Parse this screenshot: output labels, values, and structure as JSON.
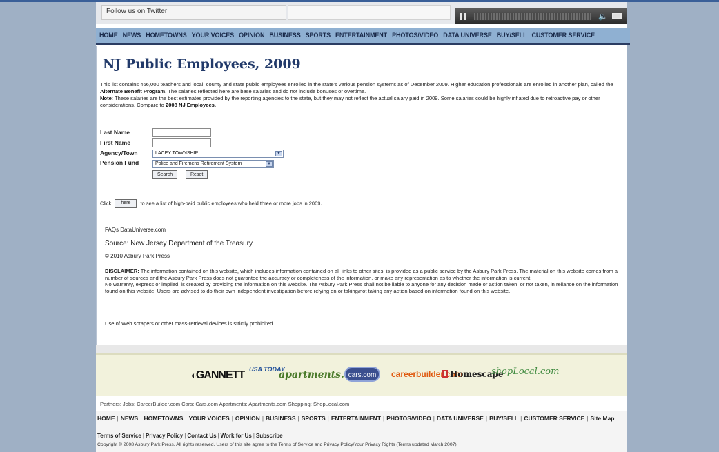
{
  "topbar": {
    "twitter_prefix": "Follow us on ",
    "twitter_link": "Twitter",
    "player_icons": [
      "pause-icon",
      "volume-icon",
      "fullscreen-icon"
    ]
  },
  "nav": {
    "items": [
      "HOME",
      "NEWS",
      "HOMETOWNS",
      "YOUR VOICES",
      "OPINION",
      "BUSINESS",
      "SPORTS",
      "ENTERTAINMENT",
      "PHOTOS/VIDEO",
      "DATA UNIVERSE",
      "BUY/SELL",
      "CUSTOMER SERVICE"
    ]
  },
  "page": {
    "title": "NJ Public Employees, 2009",
    "intro_1": "This list contains 466,000 teachers and local, county and state public employees enrolled in the state's various pension systems as of December 2009. Higher education professionals are enrolled in another plan, called the ",
    "intro_abp": "Alternate Benefit Program",
    "intro_2": ". The salaries reflected here are base salaries and do not include bonuses or overtime.",
    "note_label": "Note",
    "note_1": ": These salaries are the ",
    "note_link": "best estimates",
    "note_2": " provided by the reporting agencies to the state, but they may not reflect the actual salary paid in 2009. Some salaries could be highly inflated due to retroactive pay or other considerations. Compare to ",
    "note_compare": "2008 NJ Employees."
  },
  "form": {
    "last_name_label": "Last Name",
    "first_name_label": "First Name",
    "agency_label": "Agency/Town",
    "pension_label": "Pension Fund",
    "last_name_value": "",
    "first_name_value": "",
    "agency_value": "LACEY TOWNSHIP",
    "pension_value": "Police and Firemens Retirement System",
    "search_label": "Search",
    "reset_label": "Reset"
  },
  "click_line": {
    "prefix": "Click",
    "button": "here",
    "suffix": "to see a list of high-paid public employees who held three or more jobs in 2009."
  },
  "footer_info": {
    "faqs": "FAQs DataUniverse.com",
    "source": "Source: New Jersey Department of the Treasury",
    "copyright": "© 2010 Asbury Park Press",
    "disclaimer_label": "DISCLAIMER:",
    "disclaimer_1": " The information contained on this website, which includes information contained on all links to other sites, is provided as a public service by the Asbury Park Press.  The material on this website comes from a number of sources and the Asbury Park Press does not guarantee the accuracy or completeness of the information, or make any representation as to whether the information is current.",
    "disclaimer_2": "No warranty, express or implied, is created by providing the information on this website. The Asbury Park Press shall not be liable to anyone for any decision made or action taken, or not taken, in reliance on the information found on this website.  Users are advised to do their own independent investigation before relying on or taking/not taking any action based on information found on this website.",
    "scrapers": "Use of Web scrapers or other mass-retrieval devices is strictly prohibited."
  },
  "sponsors": {
    "gannett": "GANNETT",
    "usatoday": "USA TODAY",
    "apartments": "apartments.com.",
    "cars": "cars.com",
    "careerbuilder": "careerbuilder.com",
    "homescape": "Homescape",
    "shoplocal": "shopLocal.com"
  },
  "partners": "Partners:  Jobs: CareerBuilder.com  Cars: Cars.com  Apartments: Apartments.com  Shopping: ShopLocal.com",
  "bottom_nav": [
    "HOME",
    "NEWS",
    "HOMETOWNS",
    "YOUR VOICES",
    "OPINION",
    "BUSINESS",
    "SPORTS",
    "ENTERTAINMENT",
    "PHOTOS/VIDEO",
    "DATA UNIVERSE",
    "BUY/SELL",
    "CUSTOMER SERVICE",
    "Site Map"
  ],
  "legal": {
    "links": [
      "Terms of Service",
      "Privacy Policy",
      "Contact Us",
      "Work for Us",
      "Subscribe"
    ],
    "copyright": "Copyright © 2008 Asbury Park Press. All rights reserved. Users of this site agree to the Terms of Service and Privacy Policy/Your Privacy Rights (Terms updated March 2007)"
  }
}
